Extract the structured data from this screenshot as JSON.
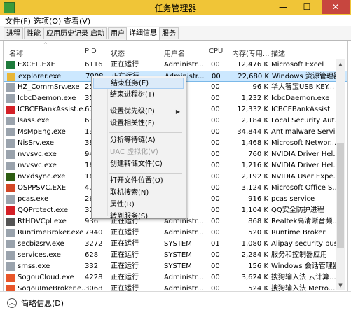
{
  "window": {
    "title": "任务管理器",
    "minimize": "—",
    "maximize": "☐",
    "close": "✕"
  },
  "menu": [
    "文件(F)",
    "选项(O)",
    "查看(V)"
  ],
  "tabs": [
    "进程",
    "性能",
    "应用历史记录",
    "启动",
    "用户",
    "详细信息",
    "服务"
  ],
  "active_tab": "详细信息",
  "columns": {
    "name": "名称",
    "pid": "PID",
    "status": "状态",
    "user": "用户名",
    "cpu": "CPU",
    "mem": "内存(专用...",
    "desc": "描述"
  },
  "rows": [
    {
      "name": "EXCEL.EXE",
      "pid": "6116",
      "status": "正在运行",
      "user": "Administr...",
      "cpu": "00",
      "mem": "12,476 K",
      "desc": "Microsoft Excel",
      "icon": "#1e7b3c",
      "icon_name": "excel-icon"
    },
    {
      "name": "explorer.exe",
      "pid": "7908",
      "status": "正在运行",
      "user": "Administr...",
      "cpu": "00",
      "mem": "22,680 K",
      "desc": "Windows 资源管理器",
      "icon": "#e8b638",
      "icon_name": "folder-icon"
    },
    {
      "name": "HZ_CommSrv.exe",
      "pid": "25",
      "status": "",
      "user": "",
      "cpu": "00",
      "mem": "96 K",
      "desc": "华大智宝USB KEY...",
      "icon": "#9aa3ad",
      "icon_name": "app-icon"
    },
    {
      "name": "IcbcDaemon.exe",
      "pid": "35",
      "status": "",
      "user": "",
      "cpu": "00",
      "mem": "1,232 K",
      "desc": "IcbcDaemon.exe",
      "icon": "#9aa3ad",
      "icon_name": "app-icon"
    },
    {
      "name": "ICBCEBankAssist.e...",
      "pid": "67",
      "status": "",
      "user": "",
      "cpu": "00",
      "mem": "12,332 K",
      "desc": "ICBCEBankAssist",
      "icon": "#d42027",
      "icon_name": "icbc-icon"
    },
    {
      "name": "lsass.exe",
      "pid": "63",
      "status": "",
      "user": "",
      "cpu": "00",
      "mem": "2,184 K",
      "desc": "Local Security Aut...",
      "icon": "#9aa3ad",
      "icon_name": "app-icon"
    },
    {
      "name": "MsMpEng.exe",
      "pid": "13",
      "status": "",
      "user": "",
      "cpu": "00",
      "mem": "34,844 K",
      "desc": "Antimalware Servi...",
      "icon": "#9aa3ad",
      "icon_name": "app-icon"
    },
    {
      "name": "NisSrv.exe",
      "pid": "38",
      "status": "",
      "user": "SE...",
      "cpu": "00",
      "mem": "1,468 K",
      "desc": "Microsoft Networ...",
      "icon": "#9aa3ad",
      "icon_name": "app-icon"
    },
    {
      "name": "nvvsvc.exe",
      "pid": "94",
      "status": "",
      "user": "",
      "cpu": "00",
      "mem": "760 K",
      "desc": "NVIDIA Driver Hel...",
      "icon": "#9aa3ad",
      "icon_name": "app-icon"
    },
    {
      "name": "nvvsvc.exe",
      "pid": "16",
      "status": "",
      "user": "",
      "cpu": "00",
      "mem": "1,216 K",
      "desc": "NVIDIA Driver Hel...",
      "icon": "#9aa3ad",
      "icon_name": "app-icon"
    },
    {
      "name": "nvxdsync.exe",
      "pid": "16",
      "status": "",
      "user": "",
      "cpu": "00",
      "mem": "2,192 K",
      "desc": "NVIDIA User Expe...",
      "icon": "#2e5d12",
      "icon_name": "nvidia-icon"
    },
    {
      "name": "OSPPSVC.EXE",
      "pid": "47",
      "status": "",
      "user": "",
      "cpu": "00",
      "mem": "3,124 K",
      "desc": "Microsoft Office S...",
      "icon": "#d24726",
      "icon_name": "office-icon"
    },
    {
      "name": "pcas.exe",
      "pid": "26",
      "status": "",
      "user": "",
      "cpu": "00",
      "mem": "916 K",
      "desc": "pcas service",
      "icon": "#9aa3ad",
      "icon_name": "app-icon"
    },
    {
      "name": "QQProtect.exe",
      "pid": "32",
      "status": "",
      "user": "",
      "cpu": "00",
      "mem": "1,104 K",
      "desc": "QQ安全防护进程",
      "icon": "#d42027",
      "icon_name": "qq-icon"
    },
    {
      "name": "RtHDVCpl.exe",
      "pid": "936",
      "status": "正在运行",
      "user": "Administr...",
      "cpu": "00",
      "mem": "868 K",
      "desc": "Realtek高清晰音频...",
      "icon": "#555555",
      "icon_name": "speaker-icon"
    },
    {
      "name": "RuntimeBroker.exe",
      "pid": "7940",
      "status": "正在运行",
      "user": "Administr...",
      "cpu": "00",
      "mem": "520 K",
      "desc": "Runtime Broker",
      "icon": "#9aa3ad",
      "icon_name": "app-icon"
    },
    {
      "name": "secbizsrv.exe",
      "pid": "3272",
      "status": "正在运行",
      "user": "SYSTEM",
      "cpu": "01",
      "mem": "1,080 K",
      "desc": "Alipay security bus...",
      "icon": "#9aa3ad",
      "icon_name": "app-icon"
    },
    {
      "name": "services.exe",
      "pid": "628",
      "status": "正在运行",
      "user": "SYSTEM",
      "cpu": "00",
      "mem": "2,284 K",
      "desc": "服务和控制器应用",
      "icon": "#9aa3ad",
      "icon_name": "app-icon"
    },
    {
      "name": "smss.exe",
      "pid": "332",
      "status": "正在运行",
      "user": "SYSTEM",
      "cpu": "00",
      "mem": "156 K",
      "desc": "Windows 会话管理器",
      "icon": "#9aa3ad",
      "icon_name": "app-icon"
    },
    {
      "name": "SogouCloud.exe",
      "pid": "4228",
      "status": "正在运行",
      "user": "Administr...",
      "cpu": "00",
      "mem": "3,624 K",
      "desc": "搜狗输入法 云计算...",
      "icon": "#e8562a",
      "icon_name": "sogou-icon"
    },
    {
      "name": "SogouImeBroker.e...",
      "pid": "3068",
      "status": "正在运行",
      "user": "Administr...",
      "cpu": "00",
      "mem": "524 K",
      "desc": "搜狗输入法 Metro...",
      "icon": "#e8562a",
      "icon_name": "sogou-icon"
    }
  ],
  "context_menu": [
    {
      "label": "结束任务(E)",
      "highlight": true
    },
    {
      "label": "结束进程树(T)"
    },
    {
      "sep": true
    },
    {
      "label": "设置优先级(P)",
      "sub": "▶"
    },
    {
      "label": "设置相关性(F)"
    },
    {
      "sep": true
    },
    {
      "label": "分析等待链(A)"
    },
    {
      "label": "UAC 虚拟化(V)",
      "disabled": true
    },
    {
      "label": "创建转储文件(C)"
    },
    {
      "sep": true
    },
    {
      "label": "打开文件位置(O)"
    },
    {
      "label": "联机搜索(N)"
    },
    {
      "label": "属性(R)"
    },
    {
      "label": "转到服务(S)"
    }
  ],
  "footer": {
    "label": "简略信息(D)",
    "icon": "︿"
  }
}
